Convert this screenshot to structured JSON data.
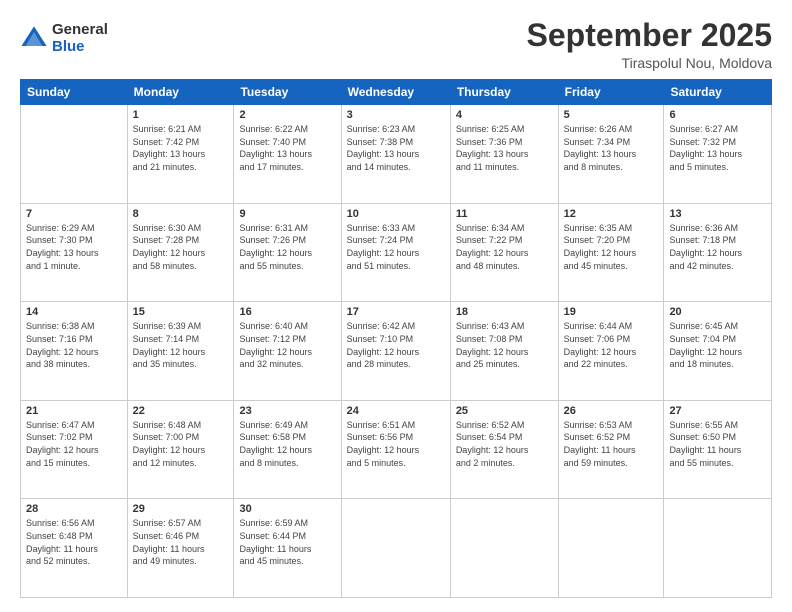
{
  "logo": {
    "general": "General",
    "blue": "Blue"
  },
  "header": {
    "month": "September 2025",
    "location": "Tiraspolul Nou, Moldova"
  },
  "weekdays": [
    "Sunday",
    "Monday",
    "Tuesday",
    "Wednesday",
    "Thursday",
    "Friday",
    "Saturday"
  ],
  "weeks": [
    [
      {
        "day": "",
        "info": ""
      },
      {
        "day": "1",
        "info": "Sunrise: 6:21 AM\nSunset: 7:42 PM\nDaylight: 13 hours\nand 21 minutes."
      },
      {
        "day": "2",
        "info": "Sunrise: 6:22 AM\nSunset: 7:40 PM\nDaylight: 13 hours\nand 17 minutes."
      },
      {
        "day": "3",
        "info": "Sunrise: 6:23 AM\nSunset: 7:38 PM\nDaylight: 13 hours\nand 14 minutes."
      },
      {
        "day": "4",
        "info": "Sunrise: 6:25 AM\nSunset: 7:36 PM\nDaylight: 13 hours\nand 11 minutes."
      },
      {
        "day": "5",
        "info": "Sunrise: 6:26 AM\nSunset: 7:34 PM\nDaylight: 13 hours\nand 8 minutes."
      },
      {
        "day": "6",
        "info": "Sunrise: 6:27 AM\nSunset: 7:32 PM\nDaylight: 13 hours\nand 5 minutes."
      }
    ],
    [
      {
        "day": "7",
        "info": "Sunrise: 6:29 AM\nSunset: 7:30 PM\nDaylight: 13 hours\nand 1 minute."
      },
      {
        "day": "8",
        "info": "Sunrise: 6:30 AM\nSunset: 7:28 PM\nDaylight: 12 hours\nand 58 minutes."
      },
      {
        "day": "9",
        "info": "Sunrise: 6:31 AM\nSunset: 7:26 PM\nDaylight: 12 hours\nand 55 minutes."
      },
      {
        "day": "10",
        "info": "Sunrise: 6:33 AM\nSunset: 7:24 PM\nDaylight: 12 hours\nand 51 minutes."
      },
      {
        "day": "11",
        "info": "Sunrise: 6:34 AM\nSunset: 7:22 PM\nDaylight: 12 hours\nand 48 minutes."
      },
      {
        "day": "12",
        "info": "Sunrise: 6:35 AM\nSunset: 7:20 PM\nDaylight: 12 hours\nand 45 minutes."
      },
      {
        "day": "13",
        "info": "Sunrise: 6:36 AM\nSunset: 7:18 PM\nDaylight: 12 hours\nand 42 minutes."
      }
    ],
    [
      {
        "day": "14",
        "info": "Sunrise: 6:38 AM\nSunset: 7:16 PM\nDaylight: 12 hours\nand 38 minutes."
      },
      {
        "day": "15",
        "info": "Sunrise: 6:39 AM\nSunset: 7:14 PM\nDaylight: 12 hours\nand 35 minutes."
      },
      {
        "day": "16",
        "info": "Sunrise: 6:40 AM\nSunset: 7:12 PM\nDaylight: 12 hours\nand 32 minutes."
      },
      {
        "day": "17",
        "info": "Sunrise: 6:42 AM\nSunset: 7:10 PM\nDaylight: 12 hours\nand 28 minutes."
      },
      {
        "day": "18",
        "info": "Sunrise: 6:43 AM\nSunset: 7:08 PM\nDaylight: 12 hours\nand 25 minutes."
      },
      {
        "day": "19",
        "info": "Sunrise: 6:44 AM\nSunset: 7:06 PM\nDaylight: 12 hours\nand 22 minutes."
      },
      {
        "day": "20",
        "info": "Sunrise: 6:45 AM\nSunset: 7:04 PM\nDaylight: 12 hours\nand 18 minutes."
      }
    ],
    [
      {
        "day": "21",
        "info": "Sunrise: 6:47 AM\nSunset: 7:02 PM\nDaylight: 12 hours\nand 15 minutes."
      },
      {
        "day": "22",
        "info": "Sunrise: 6:48 AM\nSunset: 7:00 PM\nDaylight: 12 hours\nand 12 minutes."
      },
      {
        "day": "23",
        "info": "Sunrise: 6:49 AM\nSunset: 6:58 PM\nDaylight: 12 hours\nand 8 minutes."
      },
      {
        "day": "24",
        "info": "Sunrise: 6:51 AM\nSunset: 6:56 PM\nDaylight: 12 hours\nand 5 minutes."
      },
      {
        "day": "25",
        "info": "Sunrise: 6:52 AM\nSunset: 6:54 PM\nDaylight: 12 hours\nand 2 minutes."
      },
      {
        "day": "26",
        "info": "Sunrise: 6:53 AM\nSunset: 6:52 PM\nDaylight: 11 hours\nand 59 minutes."
      },
      {
        "day": "27",
        "info": "Sunrise: 6:55 AM\nSunset: 6:50 PM\nDaylight: 11 hours\nand 55 minutes."
      }
    ],
    [
      {
        "day": "28",
        "info": "Sunrise: 6:56 AM\nSunset: 6:48 PM\nDaylight: 11 hours\nand 52 minutes."
      },
      {
        "day": "29",
        "info": "Sunrise: 6:57 AM\nSunset: 6:46 PM\nDaylight: 11 hours\nand 49 minutes."
      },
      {
        "day": "30",
        "info": "Sunrise: 6:59 AM\nSunset: 6:44 PM\nDaylight: 11 hours\nand 45 minutes."
      },
      {
        "day": "",
        "info": ""
      },
      {
        "day": "",
        "info": ""
      },
      {
        "day": "",
        "info": ""
      },
      {
        "day": "",
        "info": ""
      }
    ]
  ]
}
